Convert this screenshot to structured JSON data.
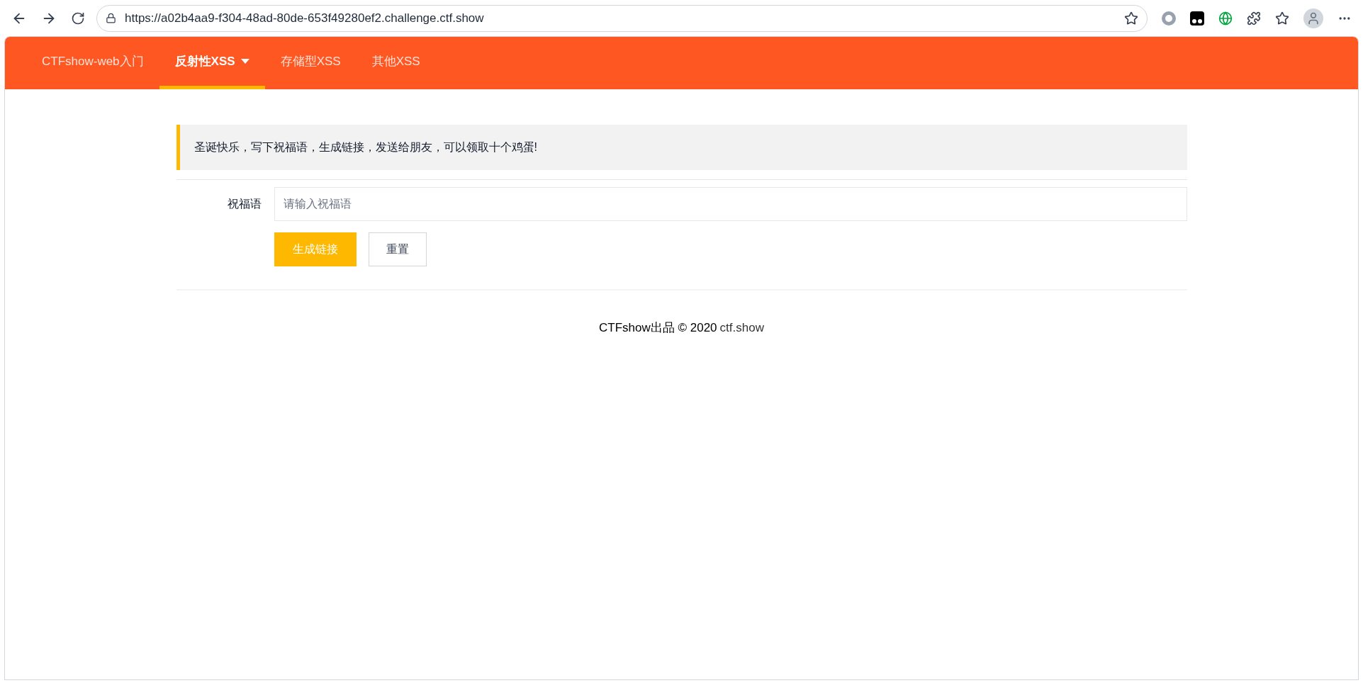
{
  "browser": {
    "url": "https://a02b4aa9-f304-48ad-80de-653f49280ef2.challenge.ctf.show"
  },
  "nav": {
    "items": [
      {
        "label": "CTFshow-web入门",
        "selected": false,
        "dropdown": false
      },
      {
        "label": "反射性XSS",
        "selected": true,
        "dropdown": true
      },
      {
        "label": "存储型XSS",
        "selected": false,
        "dropdown": false
      },
      {
        "label": "其他XSS",
        "selected": false,
        "dropdown": false
      }
    ]
  },
  "notice": "圣诞快乐，写下祝福语，生成链接，发送给朋友，可以领取十个鸡蛋!",
  "form": {
    "label": "祝福语",
    "placeholder": "请输入祝福语",
    "buttons": [
      {
        "label": "生成链接",
        "kind": "primary"
      },
      {
        "label": "重置",
        "kind": "default"
      }
    ]
  },
  "footer": {
    "text": "CTFshow出品 © 2020",
    "link": "ctf.show"
  }
}
